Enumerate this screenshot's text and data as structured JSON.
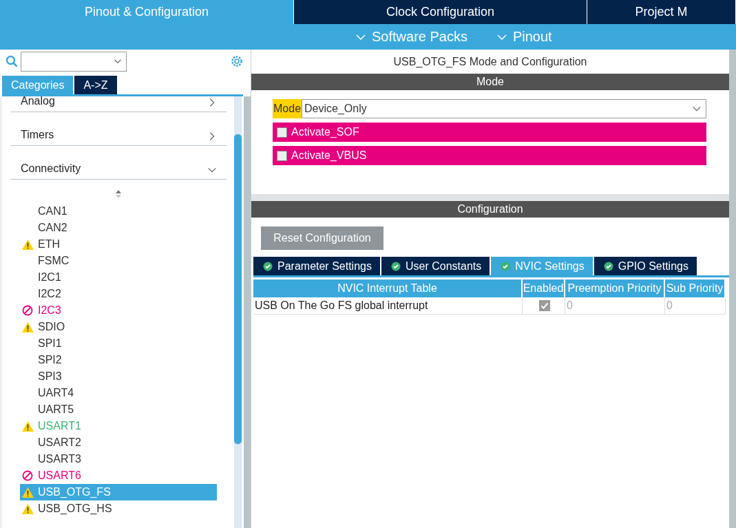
{
  "top_tabs": [
    {
      "label": "Pinout & Configuration",
      "selected": true
    },
    {
      "label": "Clock Configuration",
      "selected": false
    },
    {
      "label": "Project M",
      "selected": false
    }
  ],
  "menus": [
    "Software Packs",
    "Pinout"
  ],
  "sidebar": {
    "view_tabs": [
      {
        "label": "Categories",
        "selected": true
      },
      {
        "label": "A->Z",
        "selected": false
      }
    ],
    "categories": [
      {
        "label": "Analog",
        "expanded": false
      },
      {
        "label": "Timers",
        "expanded": false
      },
      {
        "label": "Connectivity",
        "expanded": true
      }
    ],
    "items": [
      {
        "label": "CAN1",
        "kind": "none",
        "color": "#333333",
        "selected": false
      },
      {
        "label": "CAN2",
        "kind": "none",
        "color": "#333333",
        "selected": false
      },
      {
        "label": "ETH",
        "kind": "warning",
        "color": "#333333",
        "selected": false
      },
      {
        "label": "FSMC",
        "kind": "none",
        "color": "#333333",
        "selected": false
      },
      {
        "label": "I2C1",
        "kind": "none",
        "color": "#333333",
        "selected": false
      },
      {
        "label": "I2C2",
        "kind": "none",
        "color": "#333333",
        "selected": false
      },
      {
        "label": "I2C3",
        "kind": "blocked",
        "color": "#e6007e",
        "selected": false
      },
      {
        "label": "SDIO",
        "kind": "warning",
        "color": "#333333",
        "selected": false
      },
      {
        "label": "SPI1",
        "kind": "none",
        "color": "#333333",
        "selected": false
      },
      {
        "label": "SPI2",
        "kind": "none",
        "color": "#333333",
        "selected": false
      },
      {
        "label": "SPI3",
        "kind": "none",
        "color": "#333333",
        "selected": false
      },
      {
        "label": "UART4",
        "kind": "none",
        "color": "#333333",
        "selected": false
      },
      {
        "label": "UART5",
        "kind": "none",
        "color": "#333333",
        "selected": false
      },
      {
        "label": "USART1",
        "kind": "warning",
        "color": "#3cb371",
        "selected": false
      },
      {
        "label": "USART2",
        "kind": "none",
        "color": "#333333",
        "selected": false
      },
      {
        "label": "USART3",
        "kind": "none",
        "color": "#333333",
        "selected": false
      },
      {
        "label": "USART6",
        "kind": "blocked",
        "color": "#e6007e",
        "selected": false
      },
      {
        "label": "USB_OTG_FS",
        "kind": "warning",
        "color": "#ffffff",
        "selected": true
      },
      {
        "label": "USB_OTG_HS",
        "kind": "warning",
        "color": "#333333",
        "selected": false
      }
    ]
  },
  "panel": {
    "title": "USB_OTG_FS Mode and Configuration",
    "mode_header": "Mode",
    "mode": {
      "label": "Mode",
      "value": "Device_Only"
    },
    "options": [
      {
        "label": "Activate_SOF",
        "checked": false
      },
      {
        "label": "Activate_VBUS",
        "checked": false
      }
    ],
    "config_header": "Configuration",
    "reset_button": "Reset Configuration",
    "tabs": [
      {
        "label": "Parameter Settings",
        "selected": false
      },
      {
        "label": "User Constants",
        "selected": false
      },
      {
        "label": "NVIC Settings",
        "selected": true
      },
      {
        "label": "GPIO Settings",
        "selected": false
      }
    ],
    "table": {
      "columns": [
        "NVIC Interrupt Table",
        "Enabled",
        "Preemption Priority",
        "Sub Priority"
      ],
      "rows": [
        {
          "name": "USB On The Go FS global interrupt",
          "enabled": true,
          "preemption": "0",
          "sub": "0"
        }
      ]
    }
  }
}
